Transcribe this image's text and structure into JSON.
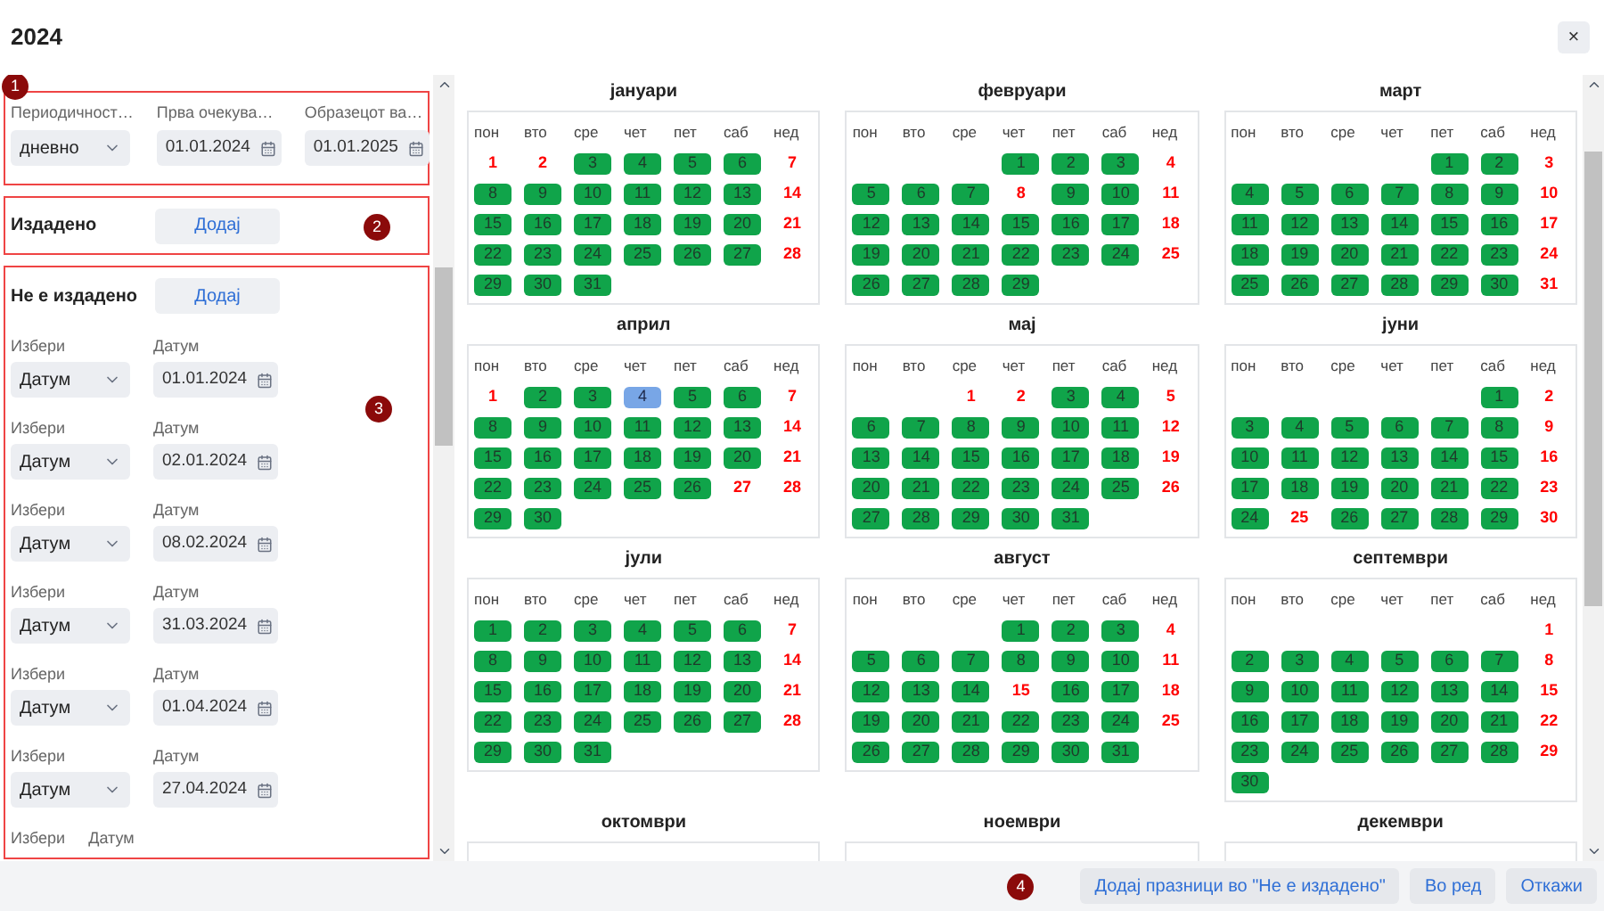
{
  "window": {
    "title": "2024",
    "close_button": "×"
  },
  "settings": {
    "badge": "1",
    "fields": [
      {
        "label": "Периодичност…",
        "kind": "select",
        "value": "дневно"
      },
      {
        "label": "Прва очекува…",
        "kind": "date",
        "value": "01.01.2024"
      },
      {
        "label": "Образецот ва…",
        "kind": "date",
        "value": "01.01.2025"
      }
    ]
  },
  "issued": {
    "badge": "2",
    "title": "Издадено",
    "button": "Додај"
  },
  "not_issued": {
    "badge": "3",
    "title": "Не е издадено",
    "button": "Додај",
    "rows": [
      {
        "select_label": "Избери",
        "select_value": "Датум",
        "date_label": "Датум",
        "date_value": "01.01.2024"
      },
      {
        "select_label": "Избери",
        "select_value": "Датум",
        "date_label": "Датум",
        "date_value": "02.01.2024"
      },
      {
        "select_label": "Избери",
        "select_value": "Датум",
        "date_label": "Датум",
        "date_value": "08.02.2024"
      },
      {
        "select_label": "Избери",
        "select_value": "Датум",
        "date_label": "Датум",
        "date_value": "31.03.2024"
      },
      {
        "select_label": "Избери",
        "select_value": "Датум",
        "date_label": "Датум",
        "date_value": "01.04.2024"
      },
      {
        "select_label": "Избери",
        "select_value": "Датум",
        "date_label": "Датум",
        "date_value": "27.04.2024"
      },
      {
        "select_label": "Избери",
        "date_label": "Датум"
      }
    ]
  },
  "months": [
    {
      "name": "јануари",
      "weekdays": [
        "пон",
        "вто",
        "сре",
        "чет",
        "пет",
        "саб",
        "нед"
      ],
      "weeks": [
        [
          {
            "n": "1",
            "kind": "off"
          },
          {
            "n": "2",
            "kind": "off"
          },
          {
            "n": "3",
            "kind": "work"
          },
          {
            "n": "4",
            "kind": "work"
          },
          {
            "n": "5",
            "kind": "work"
          },
          {
            "n": "6",
            "kind": "work"
          },
          {
            "n": "7",
            "kind": "off"
          }
        ],
        [
          {
            "n": "8",
            "kind": "work"
          },
          {
            "n": "9",
            "kind": "work"
          },
          {
            "n": "10",
            "kind": "work"
          },
          {
            "n": "11",
            "kind": "work"
          },
          {
            "n": "12",
            "kind": "work"
          },
          {
            "n": "13",
            "kind": "work"
          },
          {
            "n": "14",
            "kind": "off"
          }
        ],
        [
          {
            "n": "15",
            "kind": "work"
          },
          {
            "n": "16",
            "kind": "work"
          },
          {
            "n": "17",
            "kind": "work"
          },
          {
            "n": "18",
            "kind": "work"
          },
          {
            "n": "19",
            "kind": "work"
          },
          {
            "n": "20",
            "kind": "work"
          },
          {
            "n": "21",
            "kind": "off"
          }
        ],
        [
          {
            "n": "22",
            "kind": "work"
          },
          {
            "n": "23",
            "kind": "work"
          },
          {
            "n": "24",
            "kind": "work"
          },
          {
            "n": "25",
            "kind": "work"
          },
          {
            "n": "26",
            "kind": "work"
          },
          {
            "n": "27",
            "kind": "work"
          },
          {
            "n": "28",
            "kind": "off"
          }
        ],
        [
          {
            "n": "29",
            "kind": "work"
          },
          {
            "n": "30",
            "kind": "work"
          },
          {
            "n": "31",
            "kind": "work"
          }
        ]
      ]
    },
    {
      "name": "февруари",
      "weekdays": [
        "пон",
        "вто",
        "сре",
        "чет",
        "пет",
        "саб",
        "нед"
      ],
      "weeks": [
        [
          {
            "n": "1",
            "kind": "work"
          },
          {
            "n": "2",
            "kind": "work"
          },
          {
            "n": "3",
            "kind": "work"
          },
          {
            "n": "4",
            "kind": "off"
          }
        ],
        [
          {
            "n": "5",
            "kind": "work"
          },
          {
            "n": "6",
            "kind": "work"
          },
          {
            "n": "7",
            "kind": "work"
          },
          {
            "n": "8",
            "kind": "off"
          },
          {
            "n": "9",
            "kind": "work"
          },
          {
            "n": "10",
            "kind": "work"
          },
          {
            "n": "11",
            "kind": "off"
          }
        ],
        [
          {
            "n": "12",
            "kind": "work"
          },
          {
            "n": "13",
            "kind": "work"
          },
          {
            "n": "14",
            "kind": "work"
          },
          {
            "n": "15",
            "kind": "work"
          },
          {
            "n": "16",
            "kind": "work"
          },
          {
            "n": "17",
            "kind": "work"
          },
          {
            "n": "18",
            "kind": "off"
          }
        ],
        [
          {
            "n": "19",
            "kind": "work"
          },
          {
            "n": "20",
            "kind": "work"
          },
          {
            "n": "21",
            "kind": "work"
          },
          {
            "n": "22",
            "kind": "work"
          },
          {
            "n": "23",
            "kind": "work"
          },
          {
            "n": "24",
            "kind": "work"
          },
          {
            "n": "25",
            "kind": "off"
          }
        ],
        [
          {
            "n": "26",
            "kind": "work"
          },
          {
            "n": "27",
            "kind": "work"
          },
          {
            "n": "28",
            "kind": "work"
          },
          {
            "n": "29",
            "kind": "work"
          }
        ]
      ]
    },
    {
      "name": "март",
      "weekdays": [
        "пон",
        "вто",
        "сре",
        "чет",
        "пет",
        "саб",
        "нед"
      ],
      "weeks": [
        [
          {
            "n": "1",
            "kind": "work"
          },
          {
            "n": "2",
            "kind": "work"
          },
          {
            "n": "3",
            "kind": "off"
          }
        ],
        [
          {
            "n": "4",
            "kind": "work"
          },
          {
            "n": "5",
            "kind": "work"
          },
          {
            "n": "6",
            "kind": "work"
          },
          {
            "n": "7",
            "kind": "work"
          },
          {
            "n": "8",
            "kind": "work"
          },
          {
            "n": "9",
            "kind": "work"
          },
          {
            "n": "10",
            "kind": "off"
          }
        ],
        [
          {
            "n": "11",
            "kind": "work"
          },
          {
            "n": "12",
            "kind": "work"
          },
          {
            "n": "13",
            "kind": "work"
          },
          {
            "n": "14",
            "kind": "work"
          },
          {
            "n": "15",
            "kind": "work"
          },
          {
            "n": "16",
            "kind": "work"
          },
          {
            "n": "17",
            "kind": "off"
          }
        ],
        [
          {
            "n": "18",
            "kind": "work"
          },
          {
            "n": "19",
            "kind": "work"
          },
          {
            "n": "20",
            "kind": "work"
          },
          {
            "n": "21",
            "kind": "work"
          },
          {
            "n": "22",
            "kind": "work"
          },
          {
            "n": "23",
            "kind": "work"
          },
          {
            "n": "24",
            "kind": "off"
          }
        ],
        [
          {
            "n": "25",
            "kind": "work"
          },
          {
            "n": "26",
            "kind": "work"
          },
          {
            "n": "27",
            "kind": "work"
          },
          {
            "n": "28",
            "kind": "work"
          },
          {
            "n": "29",
            "kind": "work"
          },
          {
            "n": "30",
            "kind": "work"
          },
          {
            "n": "31",
            "kind": "off"
          }
        ]
      ]
    },
    {
      "name": "април",
      "weekdays": [
        "пон",
        "вто",
        "сре",
        "чет",
        "пет",
        "саб",
        "нед"
      ],
      "weeks": [
        [
          {
            "n": "1",
            "kind": "off"
          },
          {
            "n": "2",
            "kind": "work"
          },
          {
            "n": "3",
            "kind": "work"
          },
          {
            "n": "4",
            "kind": "picked"
          },
          {
            "n": "5",
            "kind": "work"
          },
          {
            "n": "6",
            "kind": "work"
          },
          {
            "n": "7",
            "kind": "off"
          }
        ],
        [
          {
            "n": "8",
            "kind": "work"
          },
          {
            "n": "9",
            "kind": "work"
          },
          {
            "n": "10",
            "kind": "work"
          },
          {
            "n": "11",
            "kind": "work"
          },
          {
            "n": "12",
            "kind": "work"
          },
          {
            "n": "13",
            "kind": "work"
          },
          {
            "n": "14",
            "kind": "off"
          }
        ],
        [
          {
            "n": "15",
            "kind": "work"
          },
          {
            "n": "16",
            "kind": "work"
          },
          {
            "n": "17",
            "kind": "work"
          },
          {
            "n": "18",
            "kind": "work"
          },
          {
            "n": "19",
            "kind": "work"
          },
          {
            "n": "20",
            "kind": "work"
          },
          {
            "n": "21",
            "kind": "off"
          }
        ],
        [
          {
            "n": "22",
            "kind": "work"
          },
          {
            "n": "23",
            "kind": "work"
          },
          {
            "n": "24",
            "kind": "work"
          },
          {
            "n": "25",
            "kind": "work"
          },
          {
            "n": "26",
            "kind": "work"
          },
          {
            "n": "27",
            "kind": "off"
          },
          {
            "n": "28",
            "kind": "off"
          }
        ],
        [
          {
            "n": "29",
            "kind": "work"
          },
          {
            "n": "30",
            "kind": "work"
          }
        ]
      ]
    },
    {
      "name": "мај",
      "weekdays": [
        "пон",
        "вто",
        "сре",
        "чет",
        "пет",
        "саб",
        "нед"
      ],
      "weeks": [
        [
          {
            "n": "1",
            "kind": "off"
          },
          {
            "n": "2",
            "kind": "off"
          },
          {
            "n": "3",
            "kind": "work"
          },
          {
            "n": "4",
            "kind": "work"
          },
          {
            "n": "5",
            "kind": "off"
          }
        ],
        [
          {
            "n": "6",
            "kind": "work"
          },
          {
            "n": "7",
            "kind": "work"
          },
          {
            "n": "8",
            "kind": "work"
          },
          {
            "n": "9",
            "kind": "work"
          },
          {
            "n": "10",
            "kind": "work"
          },
          {
            "n": "11",
            "kind": "work"
          },
          {
            "n": "12",
            "kind": "off"
          }
        ],
        [
          {
            "n": "13",
            "kind": "work"
          },
          {
            "n": "14",
            "kind": "work"
          },
          {
            "n": "15",
            "kind": "work"
          },
          {
            "n": "16",
            "kind": "work"
          },
          {
            "n": "17",
            "kind": "work"
          },
          {
            "n": "18",
            "kind": "work"
          },
          {
            "n": "19",
            "kind": "off"
          }
        ],
        [
          {
            "n": "20",
            "kind": "work"
          },
          {
            "n": "21",
            "kind": "work"
          },
          {
            "n": "22",
            "kind": "work"
          },
          {
            "n": "23",
            "kind": "work"
          },
          {
            "n": "24",
            "kind": "work"
          },
          {
            "n": "25",
            "kind": "work"
          },
          {
            "n": "26",
            "kind": "off"
          }
        ],
        [
          {
            "n": "27",
            "kind": "work"
          },
          {
            "n": "28",
            "kind": "work"
          },
          {
            "n": "29",
            "kind": "work"
          },
          {
            "n": "30",
            "kind": "work"
          },
          {
            "n": "31",
            "kind": "work"
          }
        ]
      ]
    },
    {
      "name": "јуни",
      "weekdays": [
        "пон",
        "вто",
        "сре",
        "чет",
        "пет",
        "саб",
        "нед"
      ],
      "weeks": [
        [
          {
            "n": "1",
            "kind": "work"
          },
          {
            "n": "2",
            "kind": "off"
          }
        ],
        [
          {
            "n": "3",
            "kind": "work"
          },
          {
            "n": "4",
            "kind": "work"
          },
          {
            "n": "5",
            "kind": "work"
          },
          {
            "n": "6",
            "kind": "work"
          },
          {
            "n": "7",
            "kind": "work"
          },
          {
            "n": "8",
            "kind": "work"
          },
          {
            "n": "9",
            "kind": "off"
          }
        ],
        [
          {
            "n": "10",
            "kind": "work"
          },
          {
            "n": "11",
            "kind": "work"
          },
          {
            "n": "12",
            "kind": "work"
          },
          {
            "n": "13",
            "kind": "work"
          },
          {
            "n": "14",
            "kind": "work"
          },
          {
            "n": "15",
            "kind": "work"
          },
          {
            "n": "16",
            "kind": "off"
          }
        ],
        [
          {
            "n": "17",
            "kind": "work"
          },
          {
            "n": "18",
            "kind": "work"
          },
          {
            "n": "19",
            "kind": "work"
          },
          {
            "n": "20",
            "kind": "work"
          },
          {
            "n": "21",
            "kind": "work"
          },
          {
            "n": "22",
            "kind": "work"
          },
          {
            "n": "23",
            "kind": "off"
          }
        ],
        [
          {
            "n": "24",
            "kind": "work"
          },
          {
            "n": "25",
            "kind": "off"
          },
          {
            "n": "26",
            "kind": "work"
          },
          {
            "n": "27",
            "kind": "work"
          },
          {
            "n": "28",
            "kind": "work"
          },
          {
            "n": "29",
            "kind": "work"
          },
          {
            "n": "30",
            "kind": "off"
          }
        ]
      ]
    },
    {
      "name": "јули",
      "weekdays": [
        "пон",
        "вто",
        "сре",
        "чет",
        "пет",
        "саб",
        "нед"
      ],
      "weeks": [
        [
          {
            "n": "1",
            "kind": "work"
          },
          {
            "n": "2",
            "kind": "work"
          },
          {
            "n": "3",
            "kind": "work"
          },
          {
            "n": "4",
            "kind": "work"
          },
          {
            "n": "5",
            "kind": "work"
          },
          {
            "n": "6",
            "kind": "work"
          },
          {
            "n": "7",
            "kind": "off"
          }
        ],
        [
          {
            "n": "8",
            "kind": "work"
          },
          {
            "n": "9",
            "kind": "work"
          },
          {
            "n": "10",
            "kind": "work"
          },
          {
            "n": "11",
            "kind": "work"
          },
          {
            "n": "12",
            "kind": "work"
          },
          {
            "n": "13",
            "kind": "work"
          },
          {
            "n": "14",
            "kind": "off"
          }
        ],
        [
          {
            "n": "15",
            "kind": "work"
          },
          {
            "n": "16",
            "kind": "work"
          },
          {
            "n": "17",
            "kind": "work"
          },
          {
            "n": "18",
            "kind": "work"
          },
          {
            "n": "19",
            "kind": "work"
          },
          {
            "n": "20",
            "kind": "work"
          },
          {
            "n": "21",
            "kind": "off"
          }
        ],
        [
          {
            "n": "22",
            "kind": "work"
          },
          {
            "n": "23",
            "kind": "work"
          },
          {
            "n": "24",
            "kind": "work"
          },
          {
            "n": "25",
            "kind": "work"
          },
          {
            "n": "26",
            "kind": "work"
          },
          {
            "n": "27",
            "kind": "work"
          },
          {
            "n": "28",
            "kind": "off"
          }
        ],
        [
          {
            "n": "29",
            "kind": "work"
          },
          {
            "n": "30",
            "kind": "work"
          },
          {
            "n": "31",
            "kind": "work"
          }
        ]
      ]
    },
    {
      "name": "август",
      "weekdays": [
        "пон",
        "вто",
        "сре",
        "чет",
        "пет",
        "саб",
        "нед"
      ],
      "weeks": [
        [
          {
            "n": "1",
            "kind": "work"
          },
          {
            "n": "2",
            "kind": "work"
          },
          {
            "n": "3",
            "kind": "work"
          },
          {
            "n": "4",
            "kind": "off"
          }
        ],
        [
          {
            "n": "5",
            "kind": "work"
          },
          {
            "n": "6",
            "kind": "work"
          },
          {
            "n": "7",
            "kind": "work"
          },
          {
            "n": "8",
            "kind": "work"
          },
          {
            "n": "9",
            "kind": "work"
          },
          {
            "n": "10",
            "kind": "work"
          },
          {
            "n": "11",
            "kind": "off"
          }
        ],
        [
          {
            "n": "12",
            "kind": "work"
          },
          {
            "n": "13",
            "kind": "work"
          },
          {
            "n": "14",
            "kind": "work"
          },
          {
            "n": "15",
            "kind": "off"
          },
          {
            "n": "16",
            "kind": "work"
          },
          {
            "n": "17",
            "kind": "work"
          },
          {
            "n": "18",
            "kind": "off"
          }
        ],
        [
          {
            "n": "19",
            "kind": "work"
          },
          {
            "n": "20",
            "kind": "work"
          },
          {
            "n": "21",
            "kind": "work"
          },
          {
            "n": "22",
            "kind": "work"
          },
          {
            "n": "23",
            "kind": "work"
          },
          {
            "n": "24",
            "kind": "work"
          },
          {
            "n": "25",
            "kind": "off"
          }
        ],
        [
          {
            "n": "26",
            "kind": "work"
          },
          {
            "n": "27",
            "kind": "work"
          },
          {
            "n": "28",
            "kind": "work"
          },
          {
            "n": "29",
            "kind": "work"
          },
          {
            "n": "30",
            "kind": "work"
          },
          {
            "n": "31",
            "kind": "work"
          }
        ]
      ]
    },
    {
      "name": "септември",
      "weekdays": [
        "пон",
        "вто",
        "сре",
        "чет",
        "пет",
        "саб",
        "нед"
      ],
      "weeks": [
        [
          {
            "n": "1",
            "kind": "off"
          }
        ],
        [
          {
            "n": "2",
            "kind": "work"
          },
          {
            "n": "3",
            "kind": "work"
          },
          {
            "n": "4",
            "kind": "work"
          },
          {
            "n": "5",
            "kind": "work"
          },
          {
            "n": "6",
            "kind": "work"
          },
          {
            "n": "7",
            "kind": "work"
          },
          {
            "n": "8",
            "kind": "off"
          }
        ],
        [
          {
            "n": "9",
            "kind": "work"
          },
          {
            "n": "10",
            "kind": "work"
          },
          {
            "n": "11",
            "kind": "work"
          },
          {
            "n": "12",
            "kind": "work"
          },
          {
            "n": "13",
            "kind": "work"
          },
          {
            "n": "14",
            "kind": "work"
          },
          {
            "n": "15",
            "kind": "off"
          }
        ],
        [
          {
            "n": "16",
            "kind": "work"
          },
          {
            "n": "17",
            "kind": "work"
          },
          {
            "n": "18",
            "kind": "work"
          },
          {
            "n": "19",
            "kind": "work"
          },
          {
            "n": "20",
            "kind": "work"
          },
          {
            "n": "21",
            "kind": "work"
          },
          {
            "n": "22",
            "kind": "off"
          }
        ],
        [
          {
            "n": "23",
            "kind": "work"
          },
          {
            "n": "24",
            "kind": "work"
          },
          {
            "n": "25",
            "kind": "work"
          },
          {
            "n": "26",
            "kind": "work"
          },
          {
            "n": "27",
            "kind": "work"
          },
          {
            "n": "28",
            "kind": "work"
          },
          {
            "n": "29",
            "kind": "off"
          }
        ],
        [
          {
            "n": "30",
            "kind": "work"
          }
        ]
      ]
    },
    {
      "name": "октомври"
    },
    {
      "name": "ноември"
    },
    {
      "name": "декември"
    }
  ],
  "footer": {
    "badge": "4",
    "buttons": [
      "Додај празници во \"Не е издадено\"",
      "Во ред",
      "Откажи"
    ]
  }
}
